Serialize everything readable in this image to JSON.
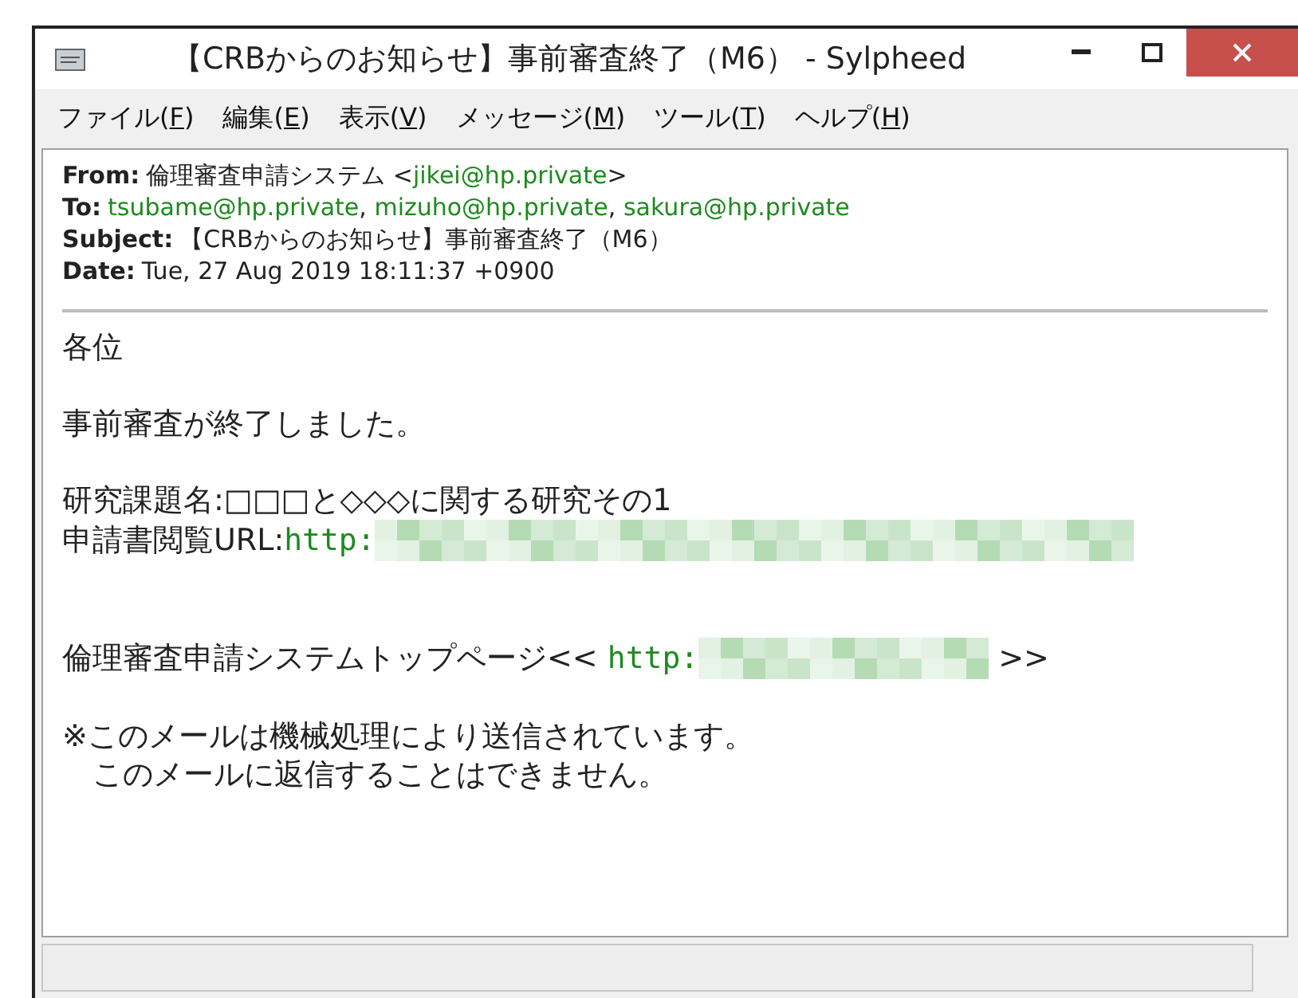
{
  "window": {
    "title": "【CRBからのお知らせ】事前審査終了（M6） - Sylpheed"
  },
  "menu": [
    {
      "text": "ファイル(",
      "mnemonic": "F",
      "tail": ")"
    },
    {
      "text": "編集(",
      "mnemonic": "E",
      "tail": ")"
    },
    {
      "text": "表示(",
      "mnemonic": "V",
      "tail": ")"
    },
    {
      "text": "メッセージ(",
      "mnemonic": "M",
      "tail": ")"
    },
    {
      "text": "ツール(",
      "mnemonic": "T",
      "tail": ")"
    },
    {
      "text": "ヘルプ(",
      "mnemonic": "H",
      "tail": ")"
    }
  ],
  "headers": [
    {
      "label": "From:",
      "parts": [
        {
          "kind": "text",
          "text": "倫理審査申請システム <"
        },
        {
          "kind": "address",
          "text": "jikei@hp.private"
        },
        {
          "kind": "text",
          "text": ">"
        }
      ]
    },
    {
      "label": "To:",
      "parts": [
        {
          "kind": "address",
          "text": "tsubame@hp.private",
          "sep": ","
        },
        {
          "kind": "address",
          "text": "mizuho@hp.private",
          "sep": ","
        },
        {
          "kind": "address",
          "text": "sakura@hp.private"
        }
      ]
    },
    {
      "label": "Subject:",
      "parts": [
        {
          "kind": "text",
          "text": "【CRBからのお知らせ】事前審査終了（M6）"
        }
      ]
    },
    {
      "label": "Date:",
      "parts": [
        {
          "kind": "text",
          "text": "Tue, 27 Aug 2019 18:11:37 +0900"
        }
      ]
    }
  ],
  "body": [
    {
      "kind": "line",
      "parts": [
        {
          "kind": "text",
          "text": "各位"
        }
      ]
    },
    {
      "kind": "blank"
    },
    {
      "kind": "line",
      "parts": [
        {
          "kind": "text",
          "text": "事前審査が終了しました。"
        }
      ]
    },
    {
      "kind": "blank"
    },
    {
      "kind": "line",
      "parts": [
        {
          "kind": "text",
          "text": "研究課題名:□□□と◇◇◇に関する研究その1"
        }
      ]
    },
    {
      "kind": "line",
      "parts": [
        {
          "kind": "text",
          "text": "申請書閲覧URL:"
        },
        {
          "kind": "link",
          "text": "http:"
        },
        {
          "kind": "longmask"
        }
      ]
    },
    {
      "kind": "blank"
    },
    {
      "kind": "blank"
    },
    {
      "kind": "line",
      "parts": [
        {
          "kind": "text",
          "text": "倫理審査申請システムトップページ<< "
        },
        {
          "kind": "link",
          "text": "http:"
        },
        {
          "kind": "shortmask"
        },
        {
          "kind": "text",
          "text": " >>"
        }
      ]
    },
    {
      "kind": "blank"
    },
    {
      "kind": "line",
      "parts": [
        {
          "kind": "text",
          "text": "※このメールは機械処理により送信されています。"
        }
      ]
    },
    {
      "kind": "line",
      "parts": [
        {
          "kind": "text",
          "text": "　このメールに返信することはできません。"
        }
      ]
    }
  ]
}
